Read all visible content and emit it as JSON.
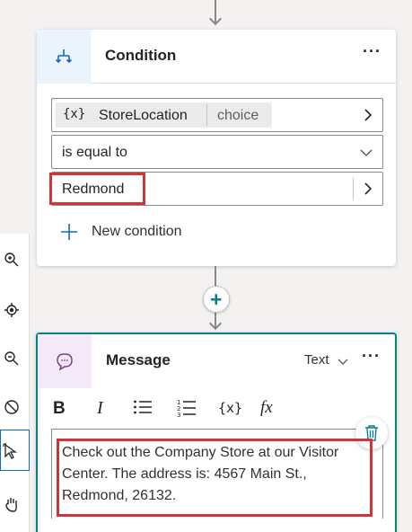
{
  "condition": {
    "title": "Condition",
    "more_label": "···",
    "variable_badge": "{x}",
    "variable_name": "StoreLocation",
    "variable_type": "choice",
    "operator": "is equal to",
    "value": "Redmond",
    "new_condition_label": "New condition"
  },
  "add_node_label": "+",
  "message": {
    "title": "Message",
    "type_label": "Text",
    "more_label": "···",
    "toolbar": {
      "bold": "B",
      "italic": "I",
      "list": "☰",
      "numbered_list": "1≡",
      "variable": "{x}",
      "formula": "fx"
    },
    "text": "Check out the Company Store at our Visitor Center. The address is: 4567 Main St., Redmond, 26132."
  },
  "colors": {
    "accent": "#0f6cbd",
    "teal": "#038387",
    "highlight": "#d13438",
    "message_icon": "#7a3f8f"
  }
}
